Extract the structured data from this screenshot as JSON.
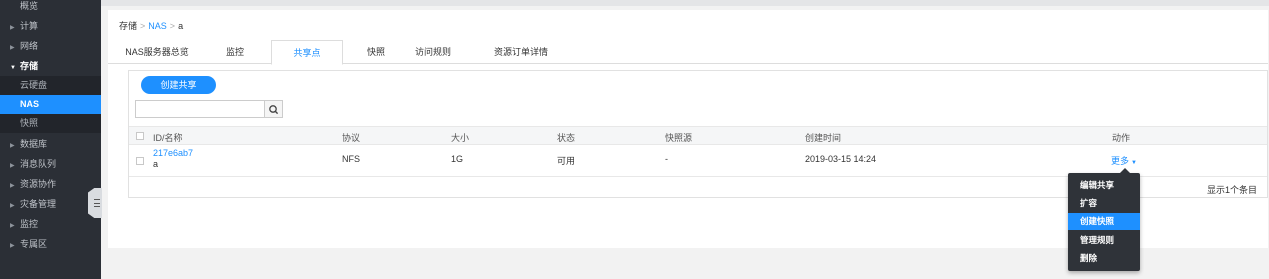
{
  "sidebar": {
    "items": [
      {
        "label": "概览"
      },
      {
        "label": "计算"
      },
      {
        "label": "网络"
      },
      {
        "label": "存储"
      },
      {
        "label": "云硬盘"
      },
      {
        "label": "NAS"
      },
      {
        "label": "快照"
      },
      {
        "label": "数据库"
      },
      {
        "label": "消息队列"
      },
      {
        "label": "资源协作"
      },
      {
        "label": "灾备管理"
      },
      {
        "label": "监控"
      },
      {
        "label": "专属区"
      }
    ]
  },
  "breadcrumb": {
    "root": "存储",
    "sep": ">",
    "parent": "NAS",
    "current": "a"
  },
  "tabs": [
    "NAS服务器总览",
    "监控",
    "共享点",
    "快照",
    "访问规则",
    "资源订单详情"
  ],
  "toolbar": {
    "create_label": "创建共享",
    "search_placeholder": ""
  },
  "table": {
    "headers": [
      "ID/名称",
      "协议",
      "大小",
      "状态",
      "快照源",
      "创建时间",
      "动作"
    ],
    "rows": [
      {
        "id": "217e6ab7",
        "name": "a",
        "protocol": "NFS",
        "size": "1G",
        "status": "可用",
        "snapshot_source": "-",
        "created": "2019-03-15 14:24",
        "action": "更多"
      }
    ],
    "count_text": "显示1个条目"
  },
  "dropdown": {
    "items": [
      "编辑共享",
      "扩容",
      "创建快照",
      "管理规则",
      "删除"
    ],
    "highlighted": "创建快照"
  },
  "colors": {
    "accent": "#1e90ff",
    "sidebar_bg": "#2b2f36",
    "menu_bg": "#2f3339"
  }
}
